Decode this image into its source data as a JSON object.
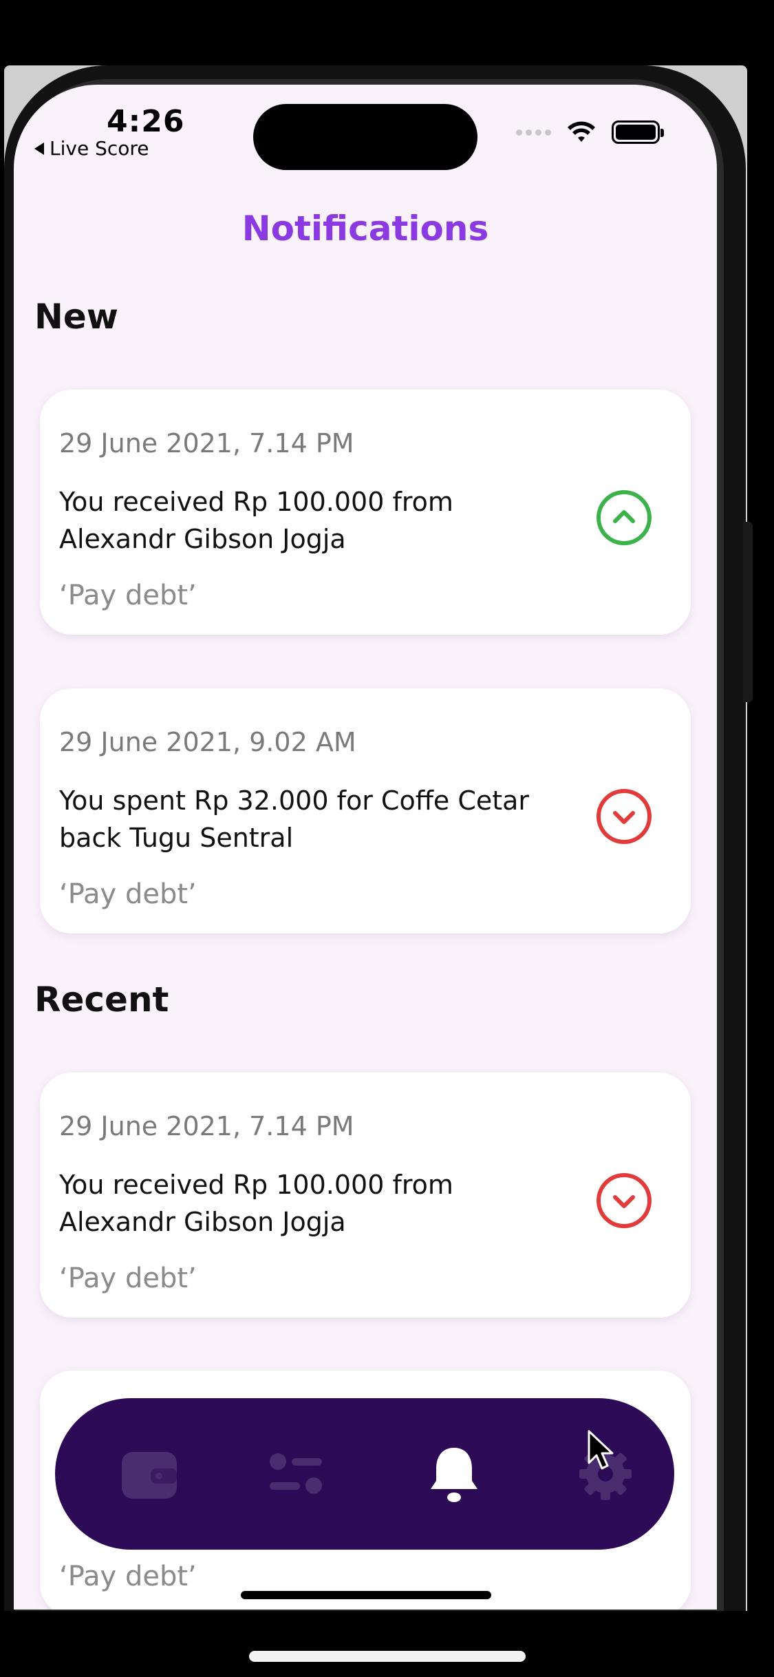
{
  "status_bar": {
    "time": "4:26",
    "back_app": "Live Score"
  },
  "header": {
    "title": "Notifications"
  },
  "sections": [
    {
      "title": "New",
      "items": [
        {
          "date": "29 June 2021, 7.14 PM",
          "message": "You received Rp 100.000 from Alexandr Gibson Jogja",
          "note": "‘Pay debt’",
          "direction": "up",
          "color": "#3bb34a"
        },
        {
          "date": "29 June 2021, 9.02 AM",
          "message": "You spent Rp 32.000 for Coffe Cetar back Tugu Sentral",
          "note": "‘Pay debt’",
          "direction": "down",
          "color": "#e23b3b"
        }
      ]
    },
    {
      "title": "Recent",
      "items": [
        {
          "date": "29 June 2021, 7.14 PM",
          "message": "You received Rp 100.000 from Alexandr Gibson Jogja",
          "note": "‘Pay debt’",
          "direction": "down",
          "color": "#e23b3b"
        },
        {
          "date": "",
          "message": "",
          "note": "‘Pay debt’",
          "direction": "",
          "color": ""
        }
      ]
    }
  ],
  "bottom_nav": {
    "items": [
      {
        "icon": "wallet-icon",
        "active": false
      },
      {
        "icon": "sliders-icon",
        "active": false
      },
      {
        "icon": "bell-icon",
        "active": true
      },
      {
        "icon": "gear-icon",
        "active": false
      }
    ],
    "background": "#2c0a56",
    "inactive_color": "#4a2d6e",
    "active_color": "#ffffff"
  },
  "colors": {
    "accent": "#8a3ae0",
    "background": "#faf2fb",
    "received": "#3bb34a",
    "spent": "#e23b3b"
  }
}
